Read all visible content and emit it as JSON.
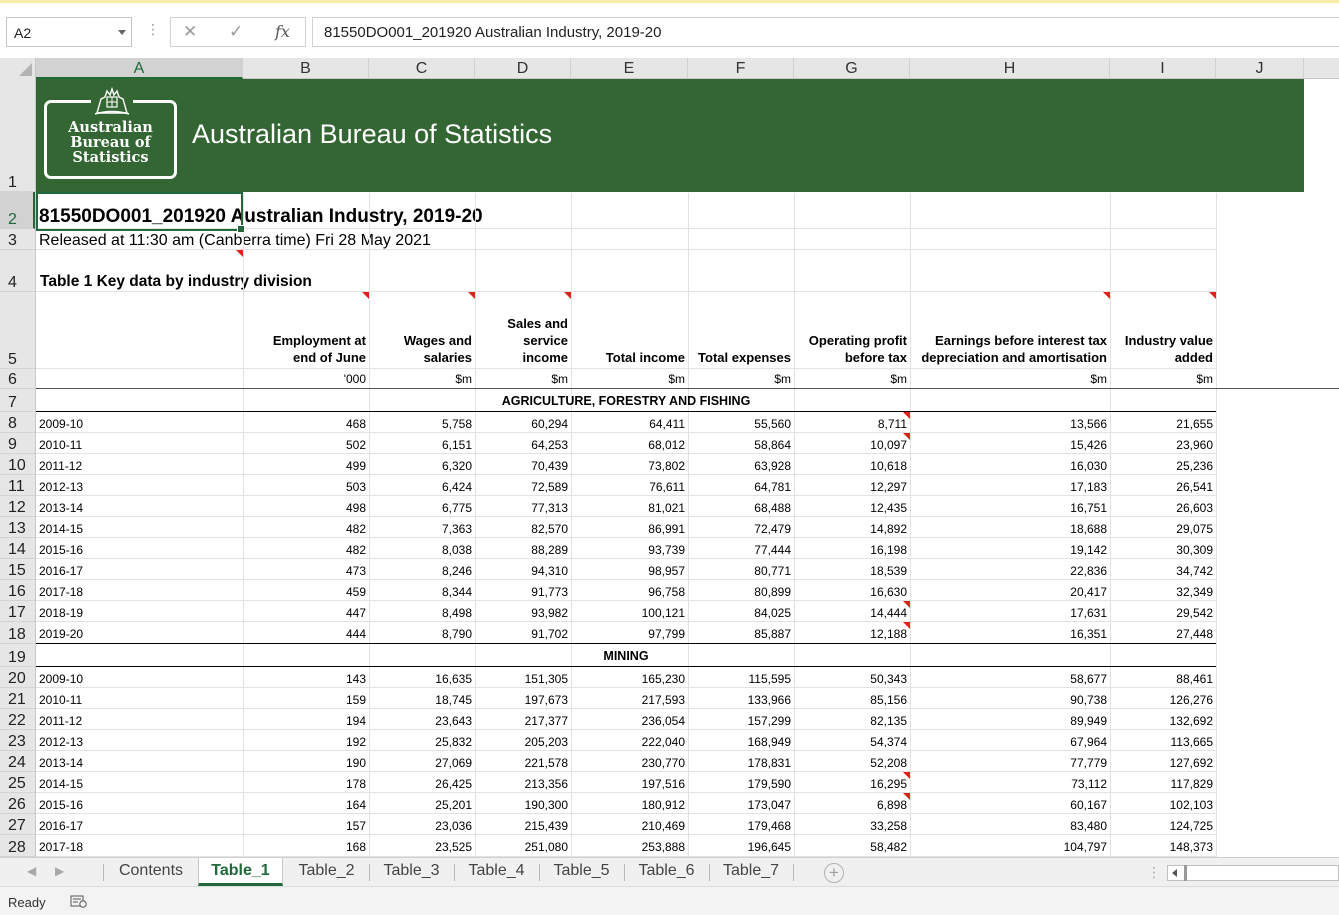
{
  "formula_bar": {
    "name_box": "A2",
    "formula": "81550DO001_201920 Australian Industry, 2019-20"
  },
  "columns": [
    "A",
    "B",
    "C",
    "D",
    "E",
    "F",
    "G",
    "H",
    "I",
    "J"
  ],
  "selected_column": "A",
  "rows": [
    "1",
    "2",
    "3",
    "4",
    "5",
    "6",
    "7",
    "8",
    "9",
    "10",
    "11",
    "12",
    "13",
    "14",
    "15",
    "16",
    "17",
    "18",
    "19",
    "20",
    "21",
    "22",
    "23",
    "24",
    "25",
    "26",
    "27",
    "28"
  ],
  "selected_row": "2",
  "banner": {
    "logo_lines": [
      "Australian",
      "Bureau of",
      "Statistics"
    ],
    "title": "Australian Bureau of Statistics",
    "color": "#336633"
  },
  "sheet": {
    "title": "81550DO001_201920 Australian Industry, 2019-20",
    "released": "Released at 11:30 am (Canberra time) Fri 28 May 2021",
    "table_title": "Table 1 Key data by industry division",
    "headers": [
      [
        "Employment at",
        "end of June"
      ],
      [
        "Wages and",
        "salaries"
      ],
      [
        "Sales and",
        "service",
        "income"
      ],
      [
        "Total income"
      ],
      [
        "Total expenses"
      ],
      [
        "Operating profit",
        "before tax"
      ],
      [
        "Earnings before interest tax",
        "depreciation and amortisation"
      ],
      [
        "Industry value",
        "added"
      ]
    ],
    "units": [
      "'000",
      "$m",
      "$m",
      "$m",
      "$m",
      "$m",
      "$m",
      "$m"
    ],
    "sections": [
      {
        "name": "AGRICULTURE, FORESTRY AND FISHING",
        "rows": [
          [
            "2009-10",
            "468",
            "5,758",
            "60,294",
            "64,411",
            "55,560",
            "8,711",
            "13,566",
            "21,655"
          ],
          [
            "2010-11",
            "502",
            "6,151",
            "64,253",
            "68,012",
            "58,864",
            "10,097",
            "15,426",
            "23,960"
          ],
          [
            "2011-12",
            "499",
            "6,320",
            "70,439",
            "73,802",
            "63,928",
            "10,618",
            "16,030",
            "25,236"
          ],
          [
            "2012-13",
            "503",
            "6,424",
            "72,589",
            "76,611",
            "64,781",
            "12,297",
            "17,183",
            "26,541"
          ],
          [
            "2013-14",
            "498",
            "6,775",
            "77,313",
            "81,021",
            "68,488",
            "12,435",
            "16,751",
            "26,603"
          ],
          [
            "2014-15",
            "482",
            "7,363",
            "82,570",
            "86,991",
            "72,479",
            "14,892",
            "18,688",
            "29,075"
          ],
          [
            "2015-16",
            "482",
            "8,038",
            "88,289",
            "93,739",
            "77,444",
            "16,198",
            "19,142",
            "30,309"
          ],
          [
            "2016-17",
            "473",
            "8,246",
            "94,310",
            "98,957",
            "80,771",
            "18,539",
            "22,836",
            "34,742"
          ],
          [
            "2017-18",
            "459",
            "8,344",
            "91,773",
            "96,758",
            "80,899",
            "16,630",
            "20,417",
            "32,349"
          ],
          [
            "2018-19",
            "447",
            "8,498",
            "93,982",
            "100,121",
            "84,025",
            "14,444",
            "17,631",
            "29,542"
          ],
          [
            "2019-20",
            "444",
            "8,790",
            "91,702",
            "97,799",
            "85,887",
            "12,188",
            "16,351",
            "27,448"
          ]
        ]
      },
      {
        "name": "MINING",
        "rows": [
          [
            "2009-10",
            "143",
            "16,635",
            "151,305",
            "165,230",
            "115,595",
            "50,343",
            "58,677",
            "88,461"
          ],
          [
            "2010-11",
            "159",
            "18,745",
            "197,673",
            "217,593",
            "133,966",
            "85,156",
            "90,738",
            "126,276"
          ],
          [
            "2011-12",
            "194",
            "23,643",
            "217,377",
            "236,054",
            "157,299",
            "82,135",
            "89,949",
            "132,692"
          ],
          [
            "2012-13",
            "192",
            "25,832",
            "205,203",
            "222,040",
            "168,949",
            "54,374",
            "67,964",
            "113,665"
          ],
          [
            "2013-14",
            "190",
            "27,069",
            "221,578",
            "230,770",
            "178,831",
            "52,208",
            "77,779",
            "127,692"
          ],
          [
            "2014-15",
            "178",
            "26,425",
            "213,356",
            "197,516",
            "179,590",
            "16,295",
            "73,112",
            "117,829"
          ],
          [
            "2015-16",
            "164",
            "25,201",
            "190,300",
            "180,912",
            "173,047",
            "6,898",
            "60,167",
            "102,103"
          ],
          [
            "2016-17",
            "157",
            "23,036",
            "215,439",
            "210,469",
            "179,468",
            "33,258",
            "83,480",
            "124,725"
          ],
          [
            "2017-18",
            "168",
            "23,525",
            "251,080",
            "253,888",
            "196,645",
            "58,482",
            "104,797",
            "148,373"
          ]
        ]
      }
    ]
  },
  "tabs": [
    "Contents",
    "Table_1",
    "Table_2",
    "Table_3",
    "Table_4",
    "Table_5",
    "Table_6",
    "Table_7"
  ],
  "active_tab": "Table_1",
  "status": {
    "ready": "Ready"
  }
}
